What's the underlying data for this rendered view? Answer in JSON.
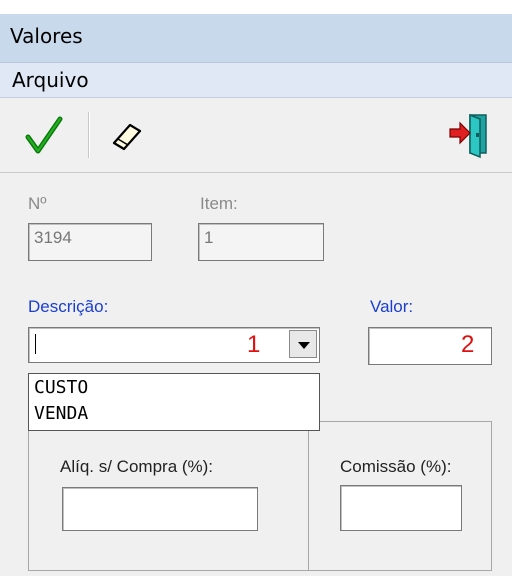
{
  "window": {
    "title": "Valores"
  },
  "menu": {
    "items": [
      "Arquivo"
    ]
  },
  "toolbar": {
    "confirm_icon": "checkmark-icon",
    "clear_icon": "eraser-icon",
    "exit_icon": "exit-door-icon"
  },
  "form": {
    "numero_label": "Nº",
    "numero_value": "3194",
    "item_label": "Item:",
    "item_value": "1",
    "descricao_label": "Descrição:",
    "descricao_value": "",
    "descricao_annotation": "1",
    "valor_label": "Valor:",
    "valor_value": "",
    "valor_annotation": "2",
    "dropdown_options": [
      "CUSTO",
      "VENDA"
    ],
    "aliq_label": "Alíq. s/ Compra (%):",
    "aliq_value": "",
    "comissao_label": "Comissão (%):",
    "comissao_value": ""
  },
  "colors": {
    "label_active": "#1a3fd0",
    "annotation": "#e01010",
    "titlebar": "#c9d9ec",
    "menubar": "#dfe8f4"
  }
}
